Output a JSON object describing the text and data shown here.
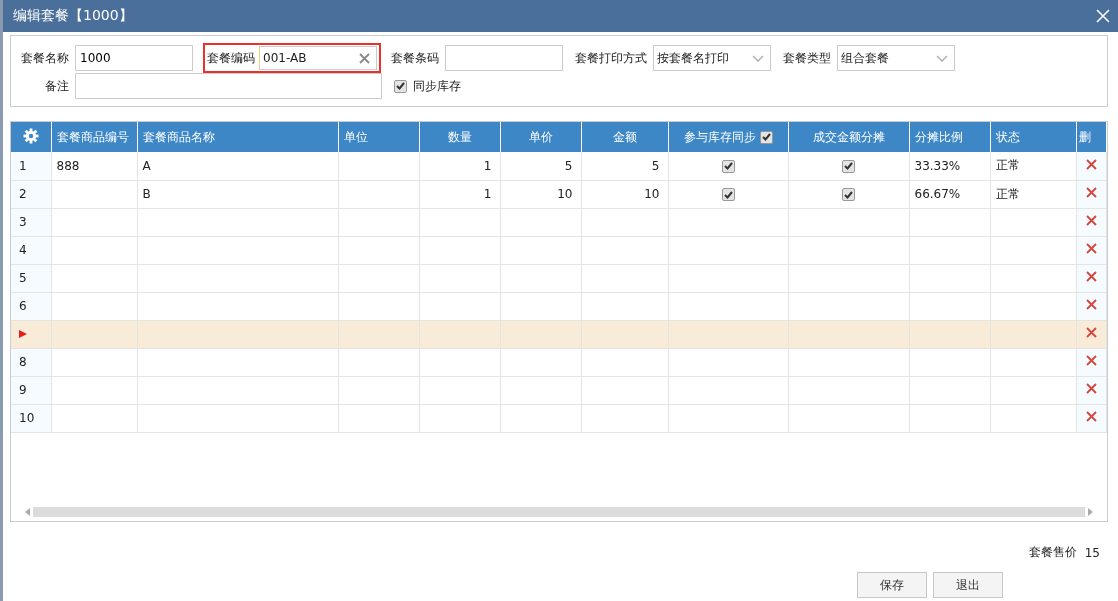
{
  "window": {
    "title": "编辑套餐【1000】"
  },
  "form": {
    "name": {
      "label": "套餐名称",
      "value": "1000"
    },
    "code": {
      "label": "套餐编码",
      "value": "001-AB",
      "highlighted": true
    },
    "barcode": {
      "label": "套餐条码"
    },
    "print_mode": {
      "label": "套餐打印方式",
      "value": "按套餐名打印"
    },
    "type": {
      "label": "套餐类型",
      "value": "组合套餐"
    },
    "remark": {
      "label": "备注"
    },
    "sync_stock": {
      "label": "同步库存",
      "checked": true
    }
  },
  "table": {
    "columns": [
      {
        "label": "套餐商品编号",
        "kind": "text"
      },
      {
        "label": "套餐商品名称",
        "kind": "text"
      },
      {
        "label": "单位",
        "kind": "text"
      },
      {
        "label": "数量",
        "kind": "number"
      },
      {
        "label": "单价",
        "kind": "number"
      },
      {
        "label": "金额",
        "kind": "number"
      },
      {
        "label": "参与库存同步",
        "kind": "check",
        "header_checked": true
      },
      {
        "label": "成交金额分摊",
        "kind": "check"
      },
      {
        "label": "分摊比例",
        "kind": "text"
      },
      {
        "label": "状态",
        "kind": "text"
      },
      {
        "label": "删",
        "kind": "delete"
      }
    ],
    "rows": [
      {
        "number": "1",
        "current": false,
        "cells": {
          "code": "888",
          "name": "A",
          "qty": "1",
          "price": "5",
          "amount": "5",
          "stock_sync": true,
          "amount_split": true,
          "ratio": "33.33%",
          "status": "正常"
        }
      },
      {
        "number": "2",
        "current": false,
        "cells": {
          "name": "B",
          "qty": "1",
          "price": "10",
          "amount": "10",
          "stock_sync": true,
          "amount_split": true,
          "ratio": "66.67%",
          "status": "正常"
        }
      },
      {
        "number": "3",
        "current": false,
        "cells": {}
      },
      {
        "number": "4",
        "current": false,
        "cells": {}
      },
      {
        "number": "5",
        "current": false,
        "cells": {}
      },
      {
        "number": "6",
        "current": false,
        "cells": {}
      },
      {
        "current": true,
        "cells": {}
      },
      {
        "number": "8",
        "current": false,
        "cells": {}
      },
      {
        "number": "9",
        "current": false,
        "cells": {}
      },
      {
        "number": "10",
        "current": false,
        "cells": {}
      }
    ]
  },
  "footer": {
    "price_label": "套餐售价",
    "price_value": "15",
    "buttons": [
      {
        "label": "保存"
      },
      {
        "label": "退出"
      }
    ]
  }
}
